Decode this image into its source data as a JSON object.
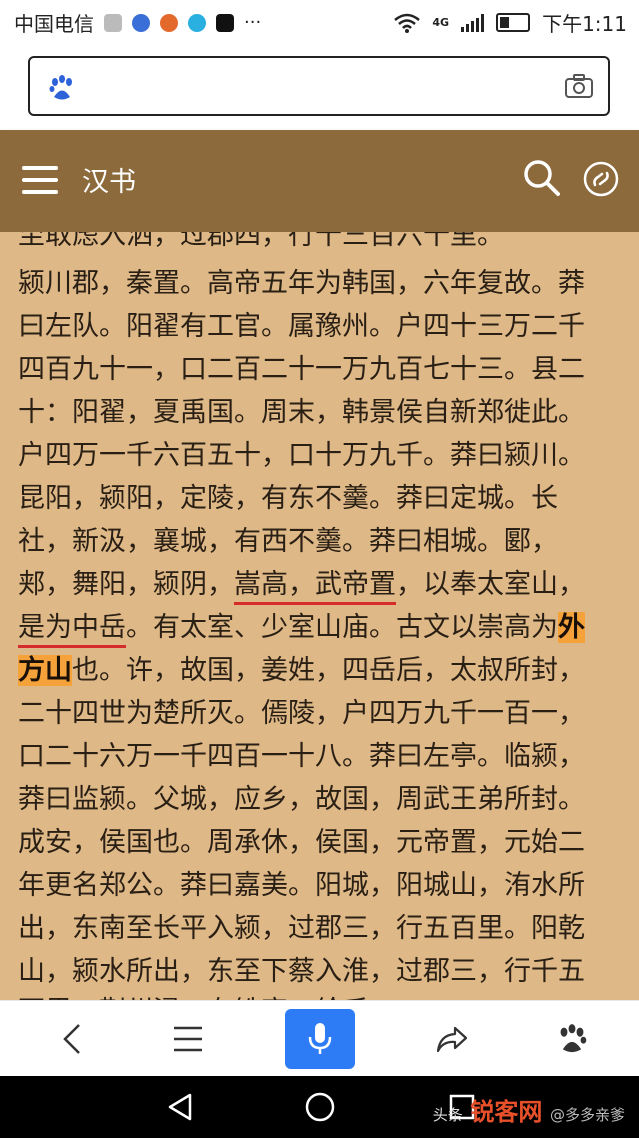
{
  "status_bar": {
    "carrier": "中国电信",
    "network": "4G",
    "time": "下午1:11"
  },
  "search": {
    "value": "",
    "placeholder": ""
  },
  "header": {
    "title": "汉书"
  },
  "content": {
    "lines": [
      "至取虑入泗，过郡四，行十三百六十里。",
      "颍川郡，秦置。高帝五年为韩国，六年复故。莽",
      "曰左队。阳翟有工官。属豫州。户四十三万二千",
      "四百九十一，口二百二十一万九百七十三。县二",
      "十：阳翟，夏禹国。周末，韩景侯自新郑徙此。",
      "户四万一千六百五十，口十万九千。莽曰颍川。",
      "昆阳，颍阳，定陵，有东不羹。莽曰定城。长",
      "社，新汲，襄城，有西不羹。莽曰相城。郾，",
      "郏，舞阳，颍阴，",
      "嵩高，武帝置",
      "，以奉太室山，",
      "是为中岳",
      "。有太室、少室山庙。古文以崇高为",
      "外",
      "方山",
      "也。许，故国，姜姓，四岳后，太叔所封，",
      "二十四世为楚所灭。傿陵，户四万九千一百一，",
      "口二十六万一千四百一十八。莽曰左亭。临颍，",
      "莽曰监颍。父城，应乡，故国，周武王弟所封。",
      "成安，侯国也。周承休，侯国，元帝置，元始二",
      "年更名郑公。莽曰嘉美。阳城，阳城山，洧水所",
      "出，东南至长平入颍，过郡三，行五百里。阳乾",
      "山，颍水所出，东至下蔡入淮，过郡三，行千五",
      "百里。荆州浸。有铁官。纶氏，"
    ]
  },
  "watermark": {
    "prefix": "头条",
    "brand": "锐客网",
    "sub": "@多多亲爹"
  },
  "colors": {
    "header_bg": "#8c6a3c",
    "page_bg": "#deb887",
    "highlight": "#f5a23a",
    "underline": "#d52b2b",
    "mic_bg": "#2d7cf6"
  }
}
